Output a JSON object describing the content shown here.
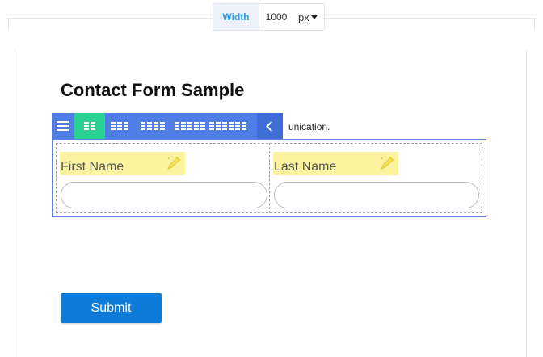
{
  "width_control": {
    "label": "Width",
    "value": "1000",
    "unit": "px"
  },
  "form": {
    "title": "Contact Form Sample",
    "partial_text": "unication.",
    "fields": [
      {
        "label": "First Name",
        "value": ""
      },
      {
        "label": "Last Name",
        "value": ""
      }
    ],
    "submit_label": "Submit"
  },
  "toolbar": {
    "buttons": [
      "menu-icon",
      "two-column-icon",
      "three-column-icon",
      "four-column-icon",
      "five-column-icon",
      "six-column-icon",
      "collapse-chevron-icon"
    ],
    "active": "two-column-icon"
  },
  "colors": {
    "toolbar": "#4f7fe6",
    "toolbar_active": "#2bd190",
    "label_highlight": "#fbf3a0",
    "submit": "#0f7bd8",
    "width_label": "#2aa0e3"
  }
}
